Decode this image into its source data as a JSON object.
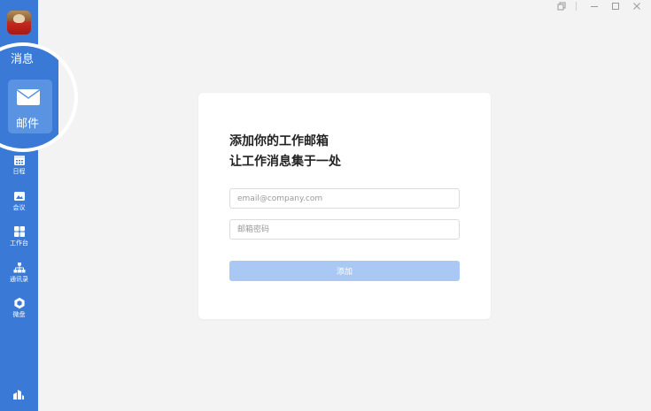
{
  "window_controls": [
    "restore-icon",
    "minimize-icon",
    "maximize-icon",
    "close-icon"
  ],
  "sidebar": {
    "items": [
      {
        "label": "消息",
        "icon": "chat-icon"
      },
      {
        "label": "邮件",
        "icon": "mail-icon"
      },
      {
        "label": "日程",
        "icon": "calendar-icon"
      },
      {
        "label": "会议",
        "icon": "meeting-icon"
      },
      {
        "label": "工作台",
        "icon": "workbench-icon"
      },
      {
        "label": "通讯录",
        "icon": "contacts-icon"
      },
      {
        "label": "微盘",
        "icon": "drive-icon"
      }
    ]
  },
  "card": {
    "title_line1": "添加你的工作邮箱",
    "title_line2": "让工作消息集于一处",
    "email_placeholder": "email@company.com",
    "password_placeholder": "邮箱密码",
    "email_value": "",
    "password_value": "",
    "add_label": "添加"
  },
  "colors": {
    "sidebar": "#3a7ad6",
    "button_disabled": "#a9c8f4",
    "background": "#f3f3f3"
  }
}
